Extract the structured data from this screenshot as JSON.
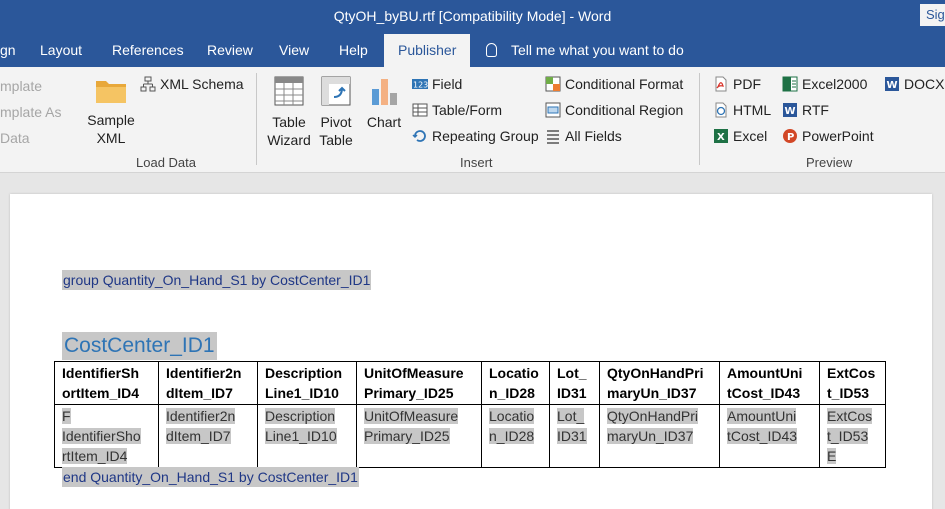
{
  "window": {
    "title": "QtyOH_byBU.rtf [Compatibility Mode]  -  Word",
    "signin": "Sig"
  },
  "tabs": [
    {
      "label": "gn"
    },
    {
      "label": "Layout"
    },
    {
      "label": "References"
    },
    {
      "label": "Review"
    },
    {
      "label": "View"
    },
    {
      "label": "Help"
    },
    {
      "label": "Publisher"
    }
  ],
  "tellme": "Tell me what you want to do",
  "ribbon": {
    "template_group": {
      "items": [
        "mplate",
        "mplate As",
        "Data"
      ]
    },
    "load_data": {
      "sample_xml_line1": "Sample",
      "sample_xml_line2": "XML",
      "xml_schema": "XML Schema",
      "label": "Load Data"
    },
    "insert": {
      "table_wizard_line1": "Table",
      "table_wizard_line2": "Wizard",
      "pivot_table_line1": "Pivot",
      "pivot_table_line2": "Table",
      "chart": "Chart",
      "field": "Field",
      "table_form": "Table/Form",
      "repeating_group": "Repeating Group",
      "conditional_format": "Conditional Format",
      "conditional_region": "Conditional Region",
      "all_fields": "All Fields",
      "label": "Insert"
    },
    "preview": {
      "pdf": "PDF",
      "html": "HTML",
      "excel": "Excel",
      "excel2000": "Excel2000",
      "rtf": "RTF",
      "powerpoint": "PowerPoint",
      "docx": "DOCX",
      "label": "Preview"
    }
  },
  "document": {
    "group_start": "group Quantity_On_Hand_S1 by CostCenter_ID1",
    "heading": "CostCenter_ID1",
    "table": {
      "headers": [
        [
          "IdentifierSh",
          "ortItem_ID4"
        ],
        [
          "Identifier2n",
          "dItem_ID7"
        ],
        [
          "Description",
          "Line1_ID10"
        ],
        [
          "UnitOfMeasure",
          "Primary_ID25"
        ],
        [
          "Locatio",
          "n_ID28"
        ],
        [
          "Lot_",
          "ID31"
        ],
        [
          "QtyOnHandPri",
          "maryUn_ID37"
        ],
        [
          "AmountUni",
          "tCost_ID43"
        ],
        [
          "ExtCos",
          "t_ID53"
        ]
      ],
      "row": [
        [
          "F",
          "IdentifierSho",
          "rtItem_ID4"
        ],
        [
          "Identifier2n",
          "dItem_ID7"
        ],
        [
          "Description",
          "Line1_ID10"
        ],
        [
          "UnitOfMeasure",
          "Primary_ID25"
        ],
        [
          "Locatio",
          "n_ID28"
        ],
        [
          "Lot_",
          "ID31"
        ],
        [
          "QtyOnHandPri",
          "maryUn_ID37"
        ],
        [
          "AmountUni",
          "tCost_ID43"
        ],
        [
          "ExtCos",
          "t_ID53",
          "E"
        ]
      ]
    },
    "group_end": "end Quantity_On_Hand_S1 by CostCenter_ID1"
  },
  "colors": {
    "title_bar": "#2b579a",
    "ribbon": "#f3f3f3",
    "field_shade": "#c7c7c7",
    "field_text": "#1f3786",
    "heading": "#2e74b5"
  }
}
